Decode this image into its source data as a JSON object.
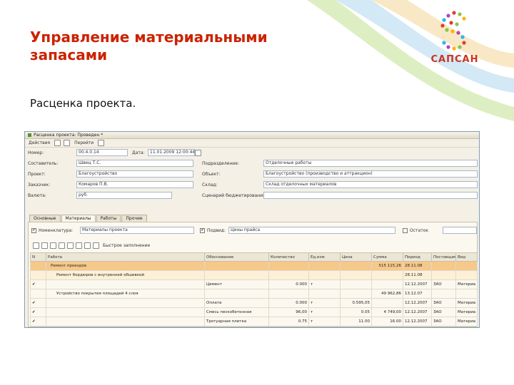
{
  "slide": {
    "title": "Управление материальными запасами",
    "subtitle": "Расценка проекта."
  },
  "logo": {
    "text": "САПСАН",
    "colors": [
      "#e53935",
      "#8bc34a",
      "#ffb300",
      "#ab47bc",
      "#29b6f6"
    ]
  },
  "window": {
    "title": "Расценка проекта: Проведен *",
    "toolbar": [
      "Действия",
      "Перейти",
      "Действия"
    ],
    "fields": {
      "number_label": "Номер:",
      "number_value": "00.4.0.14",
      "date_label": "Дата:",
      "date_value": "11.01.2009 12:00:44",
      "author_label": "Составитель:",
      "author_value": "Швец Т.С.",
      "project_label": "Проект:",
      "project_value": "Благоустройство",
      "customer_label": "Заказчик:",
      "customer_value": "Комаров П.В.",
      "currency_label": "Валюта:",
      "currency_value": "руб.",
      "subdivision_label": "Подразделение:",
      "subdivision_value": "Отделочные работы",
      "object_label": "Объект:",
      "object_value": "Благоустройство (производство и аттракцион)",
      "warehouse_label": "Склад:",
      "warehouse_value": "Склад отделочных материалов",
      "budget_label": "Сценарий бюджетирования:",
      "budget_value": ""
    },
    "tabs": [
      "Основные",
      "Материалы",
      "Работы",
      "Прочие"
    ],
    "filters": {
      "item_label": "Номенклатура:",
      "item_value": "Материалы проекта",
      "subtype_label": "Подвид:",
      "subtype_value": "Цены прайса",
      "left_label": "Остаток"
    },
    "grid_toolbar_label": "Быстрое заполнение",
    "columns": [
      "N",
      "Работа",
      "Обоснование",
      "Количество",
      "Ед.изм",
      "Цена",
      "Сумма",
      "Период",
      "Поставщик",
      "Вид"
    ],
    "rows": [
      {
        "n": "",
        "work": "Ремонт проездов",
        "basis": "",
        "qty": "",
        "unit": "",
        "price": "",
        "sum": "515 115,26",
        "period": "28.11.08",
        "supplier": "",
        "kind": "",
        "style": "hl"
      },
      {
        "n": "",
        "work": "Ремонт бордюров с внутренней обшивкой",
        "basis": "",
        "qty": "",
        "unit": "",
        "price": "",
        "sum": "",
        "period": "28.11.08",
        "supplier": "",
        "kind": "",
        "style": "sel"
      },
      {
        "n": "✔",
        "work": "",
        "basis": "Цемент",
        "qty": "0.000",
        "unit": "т",
        "price": "",
        "sum": "",
        "period": "12.12.2007",
        "supplier": "ЗАО",
        "kind": "Материа",
        "style": ""
      },
      {
        "n": "",
        "work": "Устройство покрытия площадей 4 слоя",
        "basis": "",
        "qty": "",
        "unit": "",
        "price": "",
        "sum": "49 962,86",
        "period": "13.12.07",
        "supplier": "",
        "kind": "",
        "style": ""
      },
      {
        "n": "✔",
        "work": "",
        "basis": "Оплата",
        "qty": "0.000",
        "unit": "т",
        "price": "0.595,05",
        "sum": "",
        "period": "12.12.2007",
        "supplier": "ЗАО",
        "kind": "Материа",
        "style": ""
      },
      {
        "n": "✔",
        "work": "",
        "basis": "Смесь пескобетонная",
        "qty": "96,00",
        "unit": "т",
        "price": "0.05",
        "sum": "4 749,00",
        "period": "12.12.2007",
        "supplier": "ЗАО",
        "kind": "Материа",
        "style": ""
      },
      {
        "n": "✔",
        "work": "",
        "basis": "Тротуарная плитка",
        "qty": "0.75",
        "unit": "т",
        "price": "11.00",
        "sum": "16.00",
        "period": "12.12.2007",
        "supplier": "ЗАО",
        "kind": "Материа",
        "style": ""
      }
    ]
  }
}
